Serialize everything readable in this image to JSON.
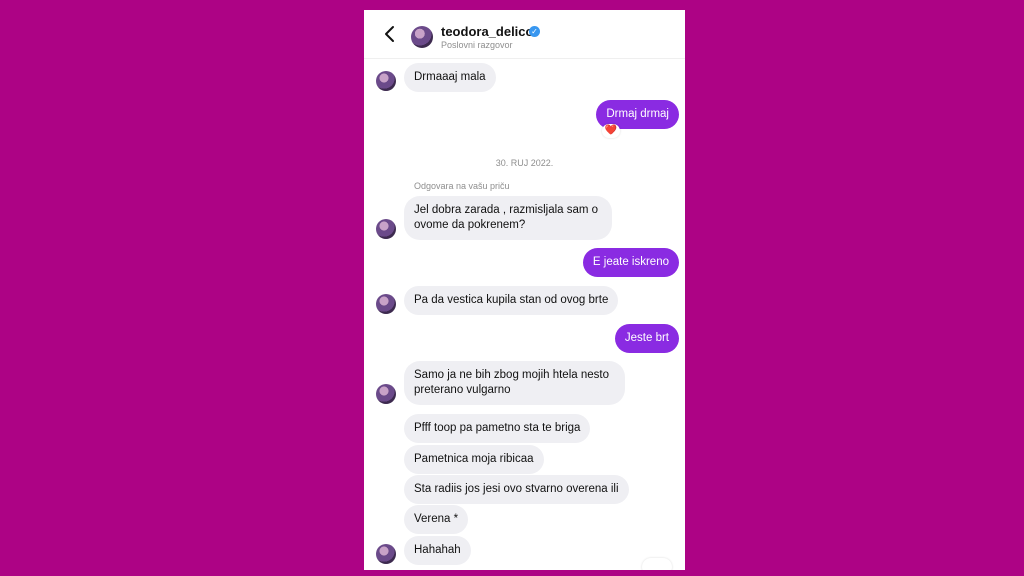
{
  "header": {
    "username": "teodora_delicc",
    "subtitle": "Poslovni razgovor",
    "verified_icon": "verified-check-icon",
    "back_icon": "chevron-left-icon"
  },
  "colors": {
    "background": "#ad0385",
    "outgoing": "#8a2be2",
    "incoming": "#efeff3",
    "verified": "#3897f0"
  },
  "messages": {
    "m1": "Drmaaaj mala",
    "m2": "Drmaj drmaj",
    "m2_reaction": "❤️",
    "date_divider": "30. RUJ 2022.",
    "reply_note": "Odgovara na vašu priču",
    "m3": "Jel dobra zarada , razmisljala sam o ovome da pokrenem?",
    "m4": "E jeate iskreno",
    "m5": "Pa da vestica kupila stan od ovog brte",
    "m6": "Jeste brt",
    "m7": "Samo ja ne bih zbog mojih htela nesto preterano vulgarno",
    "m8": "Pfff toop pa pametno sta te briga",
    "m9": "Pametnica moja ribicaa",
    "m10": "Sta radiis jos jesi ovo stvarno overena ili",
    "m11": "Verena *",
    "m12": "Hahahah"
  }
}
